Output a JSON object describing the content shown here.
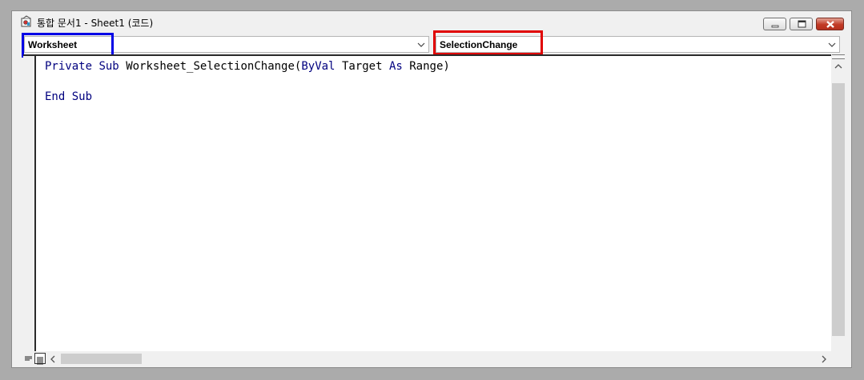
{
  "window": {
    "title": "통합 문서1 - Sheet1 (코드)"
  },
  "object_combo": {
    "value": "Worksheet"
  },
  "procedure_combo": {
    "value": "SelectionChange"
  },
  "code": {
    "line1": {
      "kw_private": "Private",
      "kw_sub": "Sub",
      "proc_name": "Worksheet_SelectionChange(",
      "kw_byval": "ByVal",
      "param": "Target",
      "kw_as": "As",
      "type": "Range)"
    },
    "line3": {
      "kw_end": "End",
      "kw_sub": "Sub"
    }
  },
  "colors": {
    "keyword": "#00007f",
    "object_highlight": "#0000e6",
    "procedure_highlight": "#e00000"
  },
  "icons": [
    "vba-module-icon",
    "minimize-icon",
    "restore-icon",
    "close-icon",
    "chevron-down-icon",
    "scroll-up-icon",
    "scroll-down-icon",
    "scroll-left-icon",
    "scroll-right-icon",
    "procedure-view-icon",
    "full-module-view-icon"
  ]
}
